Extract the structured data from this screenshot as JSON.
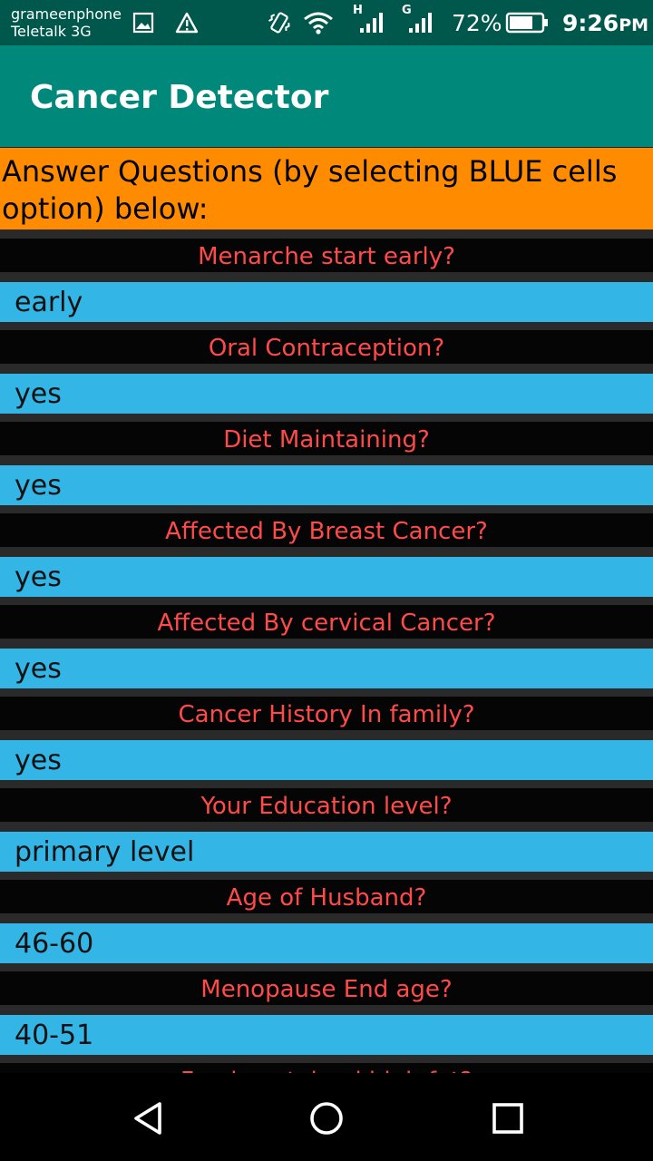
{
  "status_bar": {
    "carrier_line1": "grameenphone",
    "carrier_line2": "Teletalk 3G",
    "network1": "H",
    "network2": "G",
    "battery": "72%",
    "time": "9:26",
    "time_suffix": "PM",
    "icons": [
      "image-icon",
      "warning-icon",
      "vibrate-icon",
      "wifi-icon",
      "signal-icon",
      "signal-icon",
      "battery-icon"
    ]
  },
  "app_bar": {
    "title": "Cancer Detector"
  },
  "banner": {
    "text": "Answer Questions (by selecting BLUE cells option) below:"
  },
  "questions": [
    {
      "question": "Menarche start early?",
      "answer": "early"
    },
    {
      "question": "Oral Contraception?",
      "answer": "yes"
    },
    {
      "question": "Diet Maintaining?",
      "answer": "yes"
    },
    {
      "question": "Affected By Breast Cancer?",
      "answer": "yes"
    },
    {
      "question": "Affected By cervical Cancer?",
      "answer": "yes"
    },
    {
      "question": "Cancer History In family?",
      "answer": "yes"
    },
    {
      "question": "Your Education level?",
      "answer": "primary level"
    },
    {
      "question": "Age of Husband?",
      "answer": "46-60"
    },
    {
      "question": "Menopause End age?",
      "answer": "40-51"
    },
    {
      "question": "Food contained high fat?",
      "answer": ""
    }
  ],
  "nav_bar": {
    "icons": [
      "back-icon",
      "home-icon",
      "recents-icon"
    ]
  },
  "colors": {
    "status_bar": "#00574b",
    "app_bar": "#00897b",
    "banner": "#ff8c00",
    "question_bg": "#050505",
    "question_text": "#ff4a4a",
    "answer_bg": "#33b5e5"
  }
}
